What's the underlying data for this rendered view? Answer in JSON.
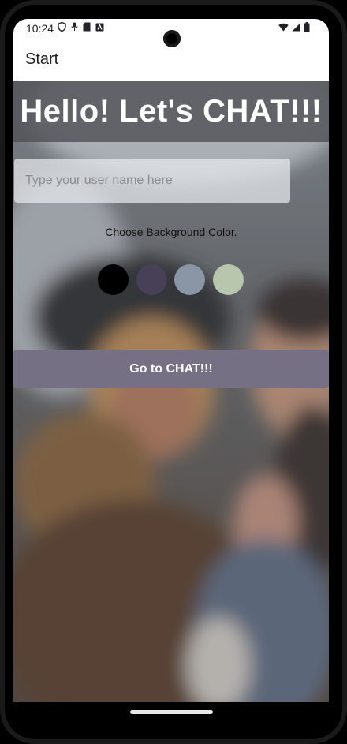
{
  "status_bar": {
    "time": "10:24",
    "left_icons": [
      "shield-icon",
      "mic-icon",
      "sd-card-icon",
      "a-box-icon"
    ],
    "right_icons": [
      "wifi-icon",
      "signal-icon",
      "battery-icon"
    ]
  },
  "app_bar": {
    "title": "Start"
  },
  "main": {
    "heading": "Hello! Let's CHAT!!!",
    "username_placeholder": "Type your user name here",
    "username_value": "",
    "choose_color_label": "Choose Background Color.",
    "color_options": [
      "#000000",
      "#474056",
      "#8A95A5",
      "#B9C6AE"
    ],
    "chat_button_label": "Go to CHAT!!!"
  },
  "colors": {
    "button_bg": "#757083",
    "heading_text": "#FFFFFF"
  }
}
